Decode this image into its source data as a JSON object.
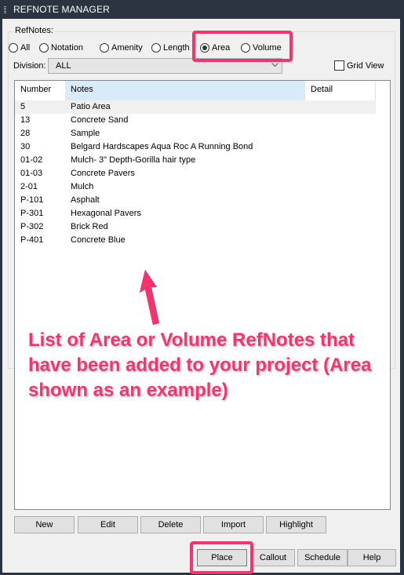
{
  "window": {
    "title": "REFNOTE MANAGER"
  },
  "refnotes": {
    "label": "RefNotes:",
    "options": [
      {
        "label": "All",
        "checked": false
      },
      {
        "label": "Notation",
        "checked": false
      },
      {
        "label": "Amenity",
        "checked": false
      },
      {
        "label": "Length",
        "checked": false
      },
      {
        "label": "Area",
        "checked": true
      },
      {
        "label": "Volume",
        "checked": false
      }
    ]
  },
  "division": {
    "label": "Division:",
    "value": "ALL"
  },
  "grid_view": {
    "label": "Grid View",
    "checked": false
  },
  "list": {
    "columns": [
      "Number",
      "Notes",
      "Detail"
    ],
    "rows": [
      {
        "number": "5",
        "note": "Patio Area"
      },
      {
        "number": "13",
        "note": "Concrete Sand"
      },
      {
        "number": "28",
        "note": "Sample"
      },
      {
        "number": "30",
        "note": "Belgard Hardscapes Aqua Roc A Running Bond"
      },
      {
        "number": "01-02",
        "note": "Mulch- 3\" Depth-Gorilla hair type"
      },
      {
        "number": "01-03",
        "note": "Concrete Pavers"
      },
      {
        "number": "2-01",
        "note": "Mulch"
      },
      {
        "number": "P-101",
        "note": "Asphalt"
      },
      {
        "number": "P-301",
        "note": "Hexagonal Pavers"
      },
      {
        "number": "P-302",
        "note": "Brick Red"
      },
      {
        "number": "P-401",
        "note": "Concrete Blue"
      }
    ]
  },
  "buttons": {
    "new": "New",
    "edit": "Edit",
    "delete": "Delete",
    "import": "Import",
    "highlight": "Highlight",
    "place": "Place",
    "callout": "Callout",
    "schedule": "Schedule",
    "help": "Help"
  },
  "annotation": {
    "text": "List of Area or Volume RefNotes that have been added to your project (Area shown as an example)",
    "color": "#f7326c"
  }
}
